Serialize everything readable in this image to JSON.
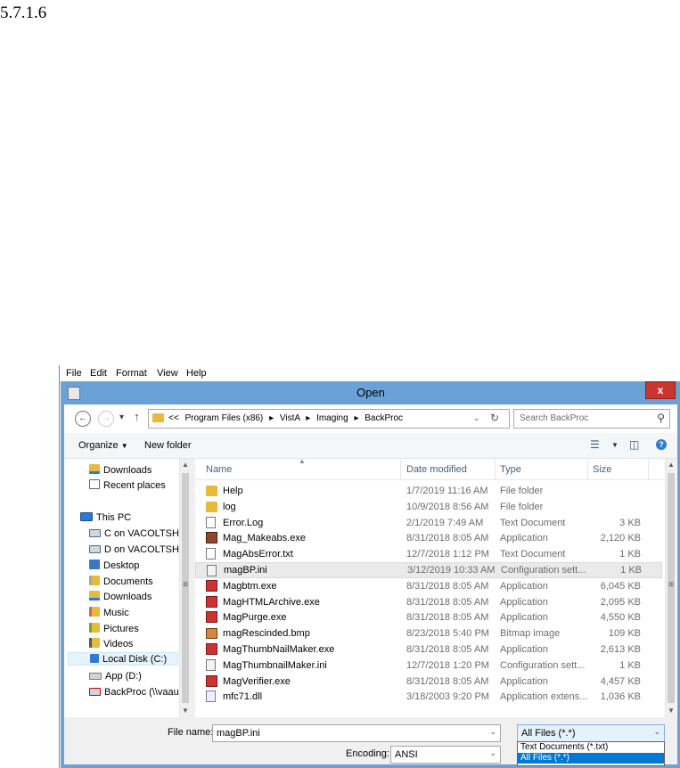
{
  "heading": "5.7.1.6",
  "menubar": [
    "File",
    "Edit",
    "Format",
    "View",
    "Help"
  ],
  "dialog": {
    "title": "Open",
    "close_glyph": "x",
    "breadcrumb": [
      "<<",
      "Program Files (x86)",
      "VistA",
      "Imaging",
      "BackProc"
    ],
    "search_placeholder": "Search BackProc",
    "organize_label": "Organize",
    "new_folder_label": "New folder"
  },
  "nav": [
    {
      "label": "Downloads",
      "icon": "downloads-icon"
    },
    {
      "label": "Recent places",
      "icon": "recent-places-icon"
    },
    {
      "label": "This PC",
      "icon": "computer-icon"
    },
    {
      "label": "C on VACOLTSH",
      "icon": "network-drive-icon"
    },
    {
      "label": "D on VACOLTSH",
      "icon": "network-drive-icon"
    },
    {
      "label": "Desktop",
      "icon": "desktop-icon"
    },
    {
      "label": "Documents",
      "icon": "documents-icon"
    },
    {
      "label": "Downloads",
      "icon": "downloads-icon"
    },
    {
      "label": "Music",
      "icon": "music-icon"
    },
    {
      "label": "Pictures",
      "icon": "pictures-icon"
    },
    {
      "label": "Videos",
      "icon": "videos-icon"
    },
    {
      "label": "Local Disk (C:)",
      "icon": "local-disk-icon",
      "selected": true
    },
    {
      "label": "App (D:)",
      "icon": "drive-icon"
    },
    {
      "label": "BackProc (\\\\vaau",
      "icon": "disconnected-drive-icon"
    }
  ],
  "columns": {
    "name": "Name",
    "date": "Date modified",
    "type": "Type",
    "size": "Size"
  },
  "files": [
    {
      "name": "Help",
      "date": "1/7/2019 11:16 AM",
      "type": "File folder",
      "size": "",
      "icon": "folder"
    },
    {
      "name": "log",
      "date": "10/9/2018 8:56 AM",
      "type": "File folder",
      "size": "",
      "icon": "folder"
    },
    {
      "name": "Error.Log",
      "date": "2/1/2019 7:49 AM",
      "type": "Text Document",
      "size": "3 KB",
      "icon": "txt"
    },
    {
      "name": "Mag_Makeabs.exe",
      "date": "8/31/2018 8:05 AM",
      "type": "Application",
      "size": "2,120 KB",
      "icon": "exe2"
    },
    {
      "name": "MagAbsError.txt",
      "date": "12/7/2018 1:12 PM",
      "type": "Text Document",
      "size": "1 KB",
      "icon": "txt"
    },
    {
      "name": "magBP.ini",
      "date": "3/12/2019 10:33 AM",
      "type": "Configuration sett...",
      "size": "1 KB",
      "icon": "ini",
      "selected": true
    },
    {
      "name": "Magbtm.exe",
      "date": "8/31/2018 8:05 AM",
      "type": "Application",
      "size": "6,045 KB",
      "icon": "exe"
    },
    {
      "name": "MagHTMLArchive.exe",
      "date": "8/31/2018 8:05 AM",
      "type": "Application",
      "size": "2,095 KB",
      "icon": "exe"
    },
    {
      "name": "MagPurge.exe",
      "date": "8/31/2018 8:05 AM",
      "type": "Application",
      "size": "4,550 KB",
      "icon": "exe"
    },
    {
      "name": "magRescinded.bmp",
      "date": "8/23/2018 5:40 PM",
      "type": "Bitmap image",
      "size": "109 KB",
      "icon": "bmp"
    },
    {
      "name": "MagThumbNailMaker.exe",
      "date": "8/31/2018 8:05 AM",
      "type": "Application",
      "size": "2,613 KB",
      "icon": "exe"
    },
    {
      "name": "MagThumbnailMaker.ini",
      "date": "12/7/2018 1:20 PM",
      "type": "Configuration sett...",
      "size": "1 KB",
      "icon": "ini"
    },
    {
      "name": "MagVerifier.exe",
      "date": "8/31/2018 8:05 AM",
      "type": "Application",
      "size": "4,457 KB",
      "icon": "exe"
    },
    {
      "name": "mfc71.dll",
      "date": "3/18/2003 9:20 PM",
      "type": "Application extens...",
      "size": "1,036 KB",
      "icon": "dll"
    }
  ],
  "bottom": {
    "file_name_label": "File name:",
    "file_name_value": "magBP.ini",
    "encoding_label": "Encoding:",
    "encoding_value": "ANSI",
    "file_type_value": "All Files  (*.*)",
    "file_type_options": [
      "Text Documents (*.txt)",
      "All Files  (*.*)"
    ]
  }
}
